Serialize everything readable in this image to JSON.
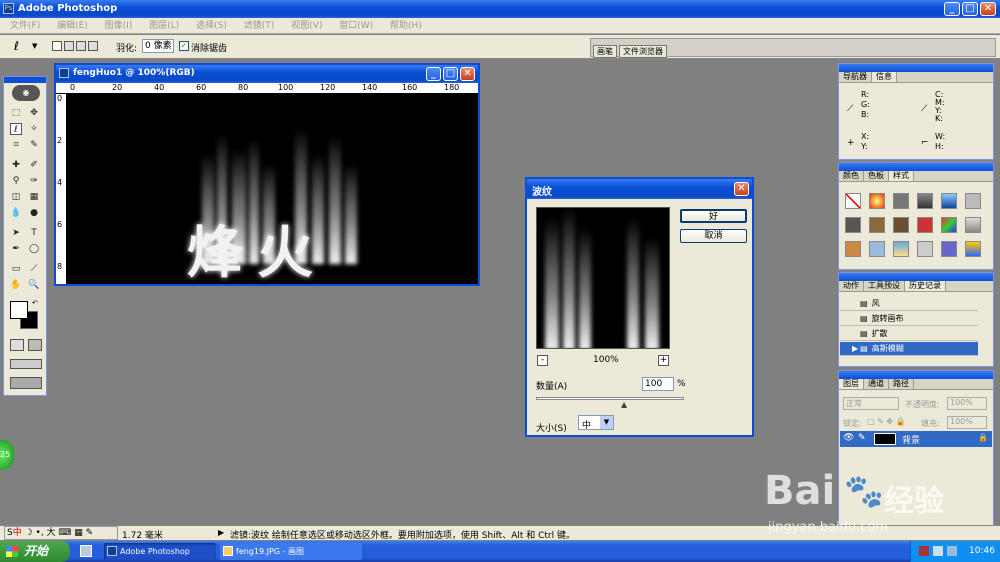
{
  "app": {
    "title": "Adobe Photoshop"
  },
  "menu": [
    "编辑(E)",
    "图像(I)",
    "图层(L)",
    "选择(S)",
    "滤镜(T)",
    "视图(V)",
    "窗口(W)",
    "帮助(H)"
  ],
  "options": {
    "feather_label": "羽化:",
    "feather_value": "0 像素",
    "antialias_label": "消除锯齿",
    "brush_tab": "画笔",
    "file_browser_tab": "文件浏览器"
  },
  "doc": {
    "title": "fengHuo1 @ 100%(RGB)",
    "ruler": [
      "0",
      "20",
      "40",
      "60",
      "80",
      "100",
      "120",
      "140",
      "160",
      "180"
    ],
    "vruler": [
      "0",
      "2",
      "4",
      "6",
      "8"
    ],
    "text": "烽火"
  },
  "dialog": {
    "title": "波纹",
    "ok": "好",
    "cancel": "取消",
    "zoom": "100%",
    "minus": "-",
    "plus": "+",
    "amount_label": "数量(A)",
    "amount_value": "100",
    "percent": "%",
    "amount_fraction": 0.6,
    "size_label": "大小(S)",
    "size_value": "中"
  },
  "navigator": {
    "tabs": [
      "导航器",
      "信息"
    ],
    "r": "R:",
    "g": "G:",
    "b": "B:",
    "c": "C:",
    "m": "M:",
    "y": "Y:",
    "k": "K:",
    "x": "X:",
    "y2": "Y:",
    "w": "W:",
    "h": "H:"
  },
  "color_panel": {
    "tabs": [
      "颜色",
      "色板",
      "样式"
    ]
  },
  "history": {
    "tabs": [
      "动作",
      "工具预设",
      "历史记录"
    ],
    "items": [
      "风",
      "旋转画布",
      "扩散",
      "高斯模糊"
    ]
  },
  "layers": {
    "tabs": [
      "图层",
      "通道",
      "路径"
    ],
    "mode": "正常",
    "opacity_label": "不透明度:",
    "opacity": "100%",
    "lock_label": "锁定:",
    "fill_label": "填充:",
    "fill": "100%",
    "layer_name": "背景"
  },
  "status": {
    "zoom": "1.72 毫米",
    "text": "滤镜:波纹  绘制任意选区或移动选区外框。要用附加选项，使用 Shift、Alt 和 Ctrl 键。",
    "ime": "中"
  },
  "watermark": {
    "brand": "Bai",
    "brand2": "经验",
    "url": "jingyan.baidu.com"
  },
  "bubble": "25",
  "taskbar": {
    "start": "开始",
    "items": [
      "Adobe Photoshop",
      "feng19.JPG - 画图"
    ],
    "time": "10:46"
  }
}
